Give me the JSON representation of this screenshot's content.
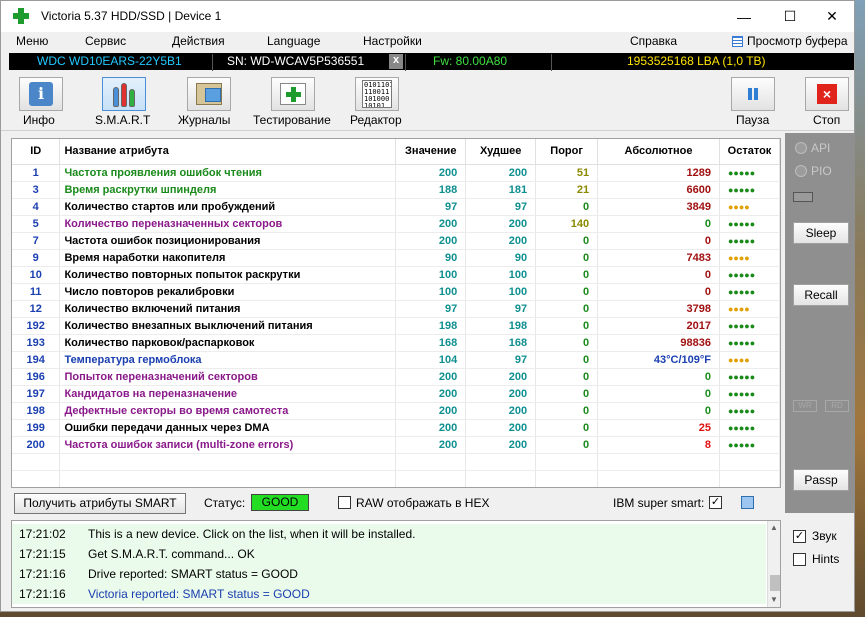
{
  "window": {
    "title": "Victoria 5.37 HDD/SSD | Device 1",
    "min": "—",
    "max": "☐",
    "close": "✕"
  },
  "menu": {
    "items": [
      "Меню",
      "Сервис",
      "Действия",
      "Language",
      "Настройки",
      "Справка"
    ],
    "buffer": "Просмотр буфера"
  },
  "device": {
    "model": "WDC WD10EARS-22Y5B1",
    "sn": "SN: WD-WCAV5P536551",
    "x": "x",
    "fw": "Fw: 80.00A80",
    "lba": "1953525168 LBA (1,0 TB)"
  },
  "toolbar": {
    "info": "Инфо",
    "smart": "S.M.A.R.T",
    "logs": "Журналы",
    "test": "Тестирование",
    "editor": "Редактор",
    "editor_icon_text": "01011010\n110011\n101000\n10101",
    "pause": "Пауза",
    "stop": "Стоп"
  },
  "table": {
    "headers": [
      "ID",
      "Название атрибута",
      "Значение",
      "Худшее",
      "Порог",
      "Абсолютное",
      "Остаток"
    ],
    "rows": [
      {
        "id": "1",
        "name": "Частота проявления ошибок чтения",
        "name_color": "#1a8a1a",
        "value": "200",
        "worst": "200",
        "thr": "51",
        "thr_color": "#8a8a00",
        "raw": "1289",
        "raw_color": "#a01010",
        "hp": "●●●●●",
        "hp_color": "#1a8a1a"
      },
      {
        "id": "3",
        "name": "Время раскрутки шпинделя",
        "name_color": "#1a8a1a",
        "value": "188",
        "worst": "181",
        "thr": "21",
        "thr_color": "#8a8a00",
        "raw": "6600",
        "raw_color": "#a01010",
        "hp": "●●●●●",
        "hp_color": "#1a8a1a"
      },
      {
        "id": "4",
        "name": "Количество стартов или пробуждений",
        "name_color": "#000000",
        "value": "97",
        "worst": "97",
        "thr": "0",
        "thr_color": "#1a8a1a",
        "raw": "3849",
        "raw_color": "#a01010",
        "hp": "●●●●",
        "hp_color": "#e0a000"
      },
      {
        "id": "5",
        "name": "Количество переназначенных секторов",
        "name_color": "#8a1a8a",
        "value": "200",
        "worst": "200",
        "thr": "140",
        "thr_color": "#8a8a00",
        "raw": "0",
        "raw_color": "#1a8a1a",
        "hp": "●●●●●",
        "hp_color": "#1a8a1a"
      },
      {
        "id": "7",
        "name": "Частота ошибок позиционирования",
        "name_color": "#000000",
        "value": "200",
        "worst": "200",
        "thr": "0",
        "thr_color": "#1a8a1a",
        "raw": "0",
        "raw_color": "#a01010",
        "hp": "●●●●●",
        "hp_color": "#1a8a1a"
      },
      {
        "id": "9",
        "name": "Время наработки накопителя",
        "name_color": "#000000",
        "value": "90",
        "worst": "90",
        "thr": "0",
        "thr_color": "#1a8a1a",
        "raw": "7483",
        "raw_color": "#a01010",
        "hp": "●●●●",
        "hp_color": "#e0a000"
      },
      {
        "id": "10",
        "name": "Количество повторных попыток раскрутки",
        "name_color": "#000000",
        "value": "100",
        "worst": "100",
        "thr": "0",
        "thr_color": "#1a8a1a",
        "raw": "0",
        "raw_color": "#a01010",
        "hp": "●●●●●",
        "hp_color": "#1a8a1a"
      },
      {
        "id": "11",
        "name": "Число повторов рекалибровки",
        "name_color": "#000000",
        "value": "100",
        "worst": "100",
        "thr": "0",
        "thr_color": "#1a8a1a",
        "raw": "0",
        "raw_color": "#a01010",
        "hp": "●●●●●",
        "hp_color": "#1a8a1a"
      },
      {
        "id": "12",
        "name": "Количество включений питания",
        "name_color": "#000000",
        "value": "97",
        "worst": "97",
        "thr": "0",
        "thr_color": "#1a8a1a",
        "raw": "3798",
        "raw_color": "#a01010",
        "hp": "●●●●",
        "hp_color": "#e0a000"
      },
      {
        "id": "192",
        "name": "Количество внезапных выключений питания",
        "name_color": "#000000",
        "value": "198",
        "worst": "198",
        "thr": "0",
        "thr_color": "#1a8a1a",
        "raw": "2017",
        "raw_color": "#a01010",
        "hp": "●●●●●",
        "hp_color": "#1a8a1a"
      },
      {
        "id": "193",
        "name": "Количество парковок/распарковок",
        "name_color": "#000000",
        "value": "168",
        "worst": "168",
        "thr": "0",
        "thr_color": "#1a8a1a",
        "raw": "98836",
        "raw_color": "#a01010",
        "hp": "●●●●●",
        "hp_color": "#1a8a1a"
      },
      {
        "id": "194",
        "name": "Температура гермоблока",
        "name_color": "#1a3fb0",
        "value": "104",
        "worst": "97",
        "thr": "0",
        "thr_color": "#1a8a1a",
        "raw": "43°C/109°F",
        "raw_color": "#1a3fb0",
        "hp": "●●●●",
        "hp_color": "#e0a000"
      },
      {
        "id": "196",
        "name": "Попыток переназначений секторов",
        "name_color": "#8a1a8a",
        "value": "200",
        "worst": "200",
        "thr": "0",
        "thr_color": "#1a8a1a",
        "raw": "0",
        "raw_color": "#1a8a1a",
        "hp": "●●●●●",
        "hp_color": "#1a8a1a"
      },
      {
        "id": "197",
        "name": "Кандидатов на переназначение",
        "name_color": "#8a1a8a",
        "value": "200",
        "worst": "200",
        "thr": "0",
        "thr_color": "#1a8a1a",
        "raw": "0",
        "raw_color": "#1a8a1a",
        "hp": "●●●●●",
        "hp_color": "#1a8a1a"
      },
      {
        "id": "198",
        "name": "Дефектные секторы во время самотеста",
        "name_color": "#8a1a8a",
        "value": "200",
        "worst": "200",
        "thr": "0",
        "thr_color": "#1a8a1a",
        "raw": "0",
        "raw_color": "#1a8a1a",
        "hp": "●●●●●",
        "hp_color": "#1a8a1a"
      },
      {
        "id": "199",
        "name": "Ошибки передачи данных через DMA",
        "name_color": "#000000",
        "value": "200",
        "worst": "200",
        "thr": "0",
        "thr_color": "#1a8a1a",
        "raw": "25",
        "raw_color": "#e01010",
        "hp": "●●●●●",
        "hp_color": "#1a8a1a"
      },
      {
        "id": "200",
        "name": "Частота ошибок записи (multi-zone errors)",
        "name_color": "#8a1a8a",
        "value": "200",
        "worst": "200",
        "thr": "0",
        "thr_color": "#1a8a1a",
        "raw": "8",
        "raw_color": "#e01010",
        "hp": "●●●●●",
        "hp_color": "#1a8a1a"
      }
    ]
  },
  "side": {
    "api": "API",
    "pio": "PIO",
    "sleep": "Sleep",
    "recall": "Recall",
    "wr": "WR",
    "rd": "RD",
    "passp": "Passp",
    "sound": "Звук",
    "hints": "Hints"
  },
  "status": {
    "get_btn": "Получить атрибуты SMART",
    "label": "Статус:",
    "value": "GOOD",
    "raw_hex": "RAW отображать в HEX",
    "ibm": "IBM super smart:",
    "check": "✓"
  },
  "log": [
    {
      "time": "17:21:02",
      "msg": "This is a new device. Click on the list, when it will be installed.",
      "color": "#000000"
    },
    {
      "time": "17:21:15",
      "msg": "Get S.M.A.R.T. command... OK",
      "color": "#000000"
    },
    {
      "time": "17:21:16",
      "msg": "Drive reported: SMART status = GOOD",
      "color": "#000000"
    },
    {
      "time": "17:21:16",
      "msg": "Victoria reported: SMART status = GOOD",
      "color": "#1a3fb0"
    }
  ]
}
